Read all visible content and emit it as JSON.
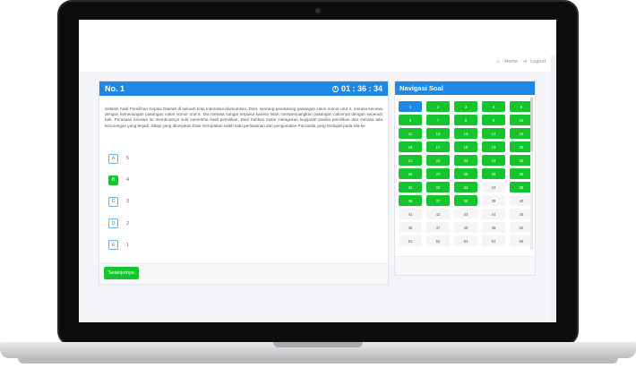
{
  "topnav": {
    "home": "Home",
    "logout": "Logout"
  },
  "question": {
    "number": "No. 1",
    "timer": "01 : 36 : 34",
    "text": "Setelah hasil Pemilihan Kepala Daerah di sebuah kota Indonesia diumumkan, Dani, seorang pendukung pasangan calon nomor urut 4, merasa kecewa dengan kemenangan pasangan calon nomor urut 5. Dia merasa sangat terpukul karena telah memperjuangkan pasangan calonnya dengan sepenuh hati. Perasaan kecewa itu membuatnya sulit menerima hasil pemilihan. Dani bahkan mulai meragukan kejujuran panitia pemilihan dan merasa ada kecurangan yang terjadi. Sikap yang ditunjukan Dani merupakan salah satu perlawanan dari pengamalan Pancasila yang terdapat pada sila ke",
    "options": [
      {
        "letter": "A",
        "text": "5"
      },
      {
        "letter": "B",
        "text": "4"
      },
      {
        "letter": "C",
        "text": "3"
      },
      {
        "letter": "D",
        "text": "2"
      },
      {
        "letter": "E",
        "text": "1"
      }
    ],
    "selected": "B",
    "next_label": "Selanjutnya"
  },
  "nav": {
    "title": "Navigasi Soal",
    "current": 1,
    "answered": [
      2,
      3,
      4,
      5,
      6,
      7,
      8,
      9,
      10,
      11,
      12,
      13,
      14,
      15,
      16,
      17,
      18,
      19,
      20,
      21,
      22,
      23,
      24,
      25,
      26,
      27,
      28,
      29,
      30,
      31,
      32,
      33,
      35,
      36,
      37,
      38
    ],
    "numbers": [
      1,
      2,
      3,
      4,
      5,
      6,
      7,
      8,
      9,
      10,
      11,
      12,
      13,
      14,
      15,
      16,
      17,
      18,
      19,
      20,
      21,
      22,
      23,
      24,
      25,
      26,
      27,
      28,
      29,
      30,
      31,
      32,
      33,
      34,
      35,
      36,
      37,
      38,
      39,
      40,
      41,
      42,
      43,
      44,
      45,
      46,
      47,
      48,
      49,
      50,
      51,
      52,
      53,
      54,
      55
    ]
  },
  "colors": {
    "primary": "#1e88e5",
    "success": "#14c52e"
  }
}
